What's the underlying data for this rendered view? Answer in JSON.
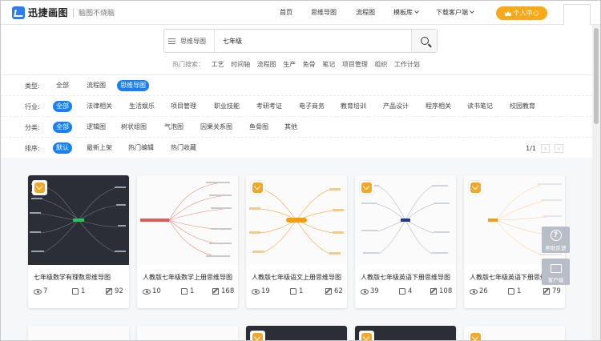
{
  "brand": {
    "name": "迅捷画图",
    "slogan": "脑图不烧脑",
    "accent": "#2f7bf6"
  },
  "nav": [
    {
      "label": "首页",
      "caret": false
    },
    {
      "label": "思维导图",
      "caret": false
    },
    {
      "label": "流程图",
      "caret": false
    },
    {
      "label": "模板库",
      "caret": true
    },
    {
      "label": "下载客户端",
      "caret": true
    }
  ],
  "user_button": {
    "label": "个人中心",
    "color": "#f8a91a"
  },
  "search": {
    "type_label": "思维导图",
    "value": "七年级",
    "hot_label": "热门搜索：",
    "hot_terms": [
      "工艺",
      "时间轴",
      "流程图",
      "生产",
      "鱼骨",
      "笔记",
      "项目管理",
      "组织",
      "工作计划"
    ]
  },
  "filters": {
    "type": {
      "label": "类型:",
      "options": [
        "全部",
        "流程图",
        "思维导图"
      ],
      "active": 2
    },
    "industry": {
      "label": "行业:",
      "options": [
        "全部",
        "法律相关",
        "生活娱乐",
        "项目管理",
        "职业技能",
        "考研考证",
        "电子商务",
        "教育培训",
        "产品设计",
        "程序相关",
        "读书笔记",
        "校园教育"
      ],
      "active": 0
    },
    "category": {
      "label": "分类:",
      "options": [
        "全部",
        "逻辑图",
        "树状组图",
        "气泡图",
        "因果关系图",
        "鱼骨图",
        "其他"
      ],
      "active": 0
    },
    "sort": {
      "label": "排序:",
      "options": [
        "默认",
        "最新上架",
        "热门编辑",
        "热门收藏"
      ],
      "active": 0
    },
    "pagination": "1/1",
    "active_color": "#1a7ff0"
  },
  "cards": [
    {
      "title": "七年级数学有理数思维导图",
      "views": "7",
      "likes": "1",
      "edits": "92",
      "theme": "dark"
    },
    {
      "title": "人教版七年级数学上册思维导图",
      "views": "10",
      "likes": "1",
      "edits": "168",
      "theme": "light"
    },
    {
      "title": "人教版七年级语文上册思维导图",
      "views": "19",
      "likes": "1",
      "edits": "62",
      "theme": "light"
    },
    {
      "title": "人教版七年级英语下册思维导图",
      "views": "39",
      "likes": "4",
      "edits": "108",
      "theme": "light"
    },
    {
      "title": "人教版七年级英语下册思维导",
      "views": "26",
      "likes": "1",
      "edits": "79",
      "theme": "light"
    }
  ],
  "float": {
    "help": "帮助反馈",
    "client": "客户端"
  }
}
